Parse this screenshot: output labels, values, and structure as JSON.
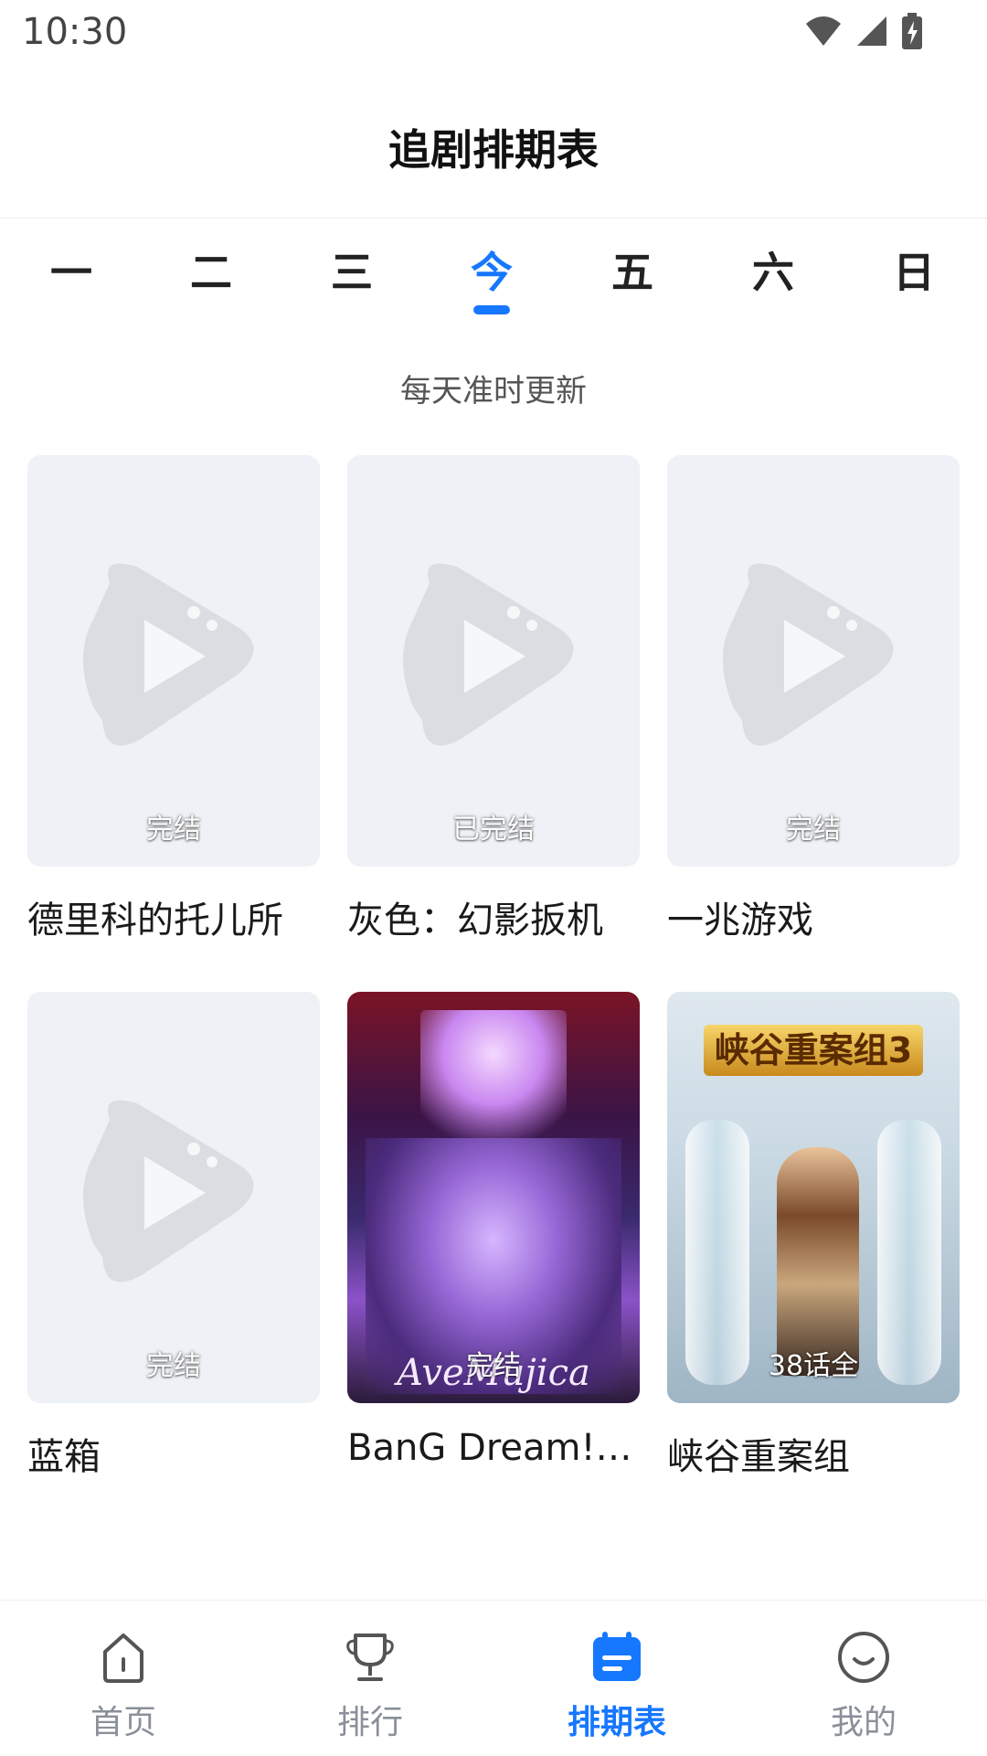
{
  "status_bar": {
    "time": "10:30"
  },
  "header": {
    "title": "追剧排期表"
  },
  "day_tabs": [
    {
      "label": "一",
      "active": false
    },
    {
      "label": "二",
      "active": false
    },
    {
      "label": "三",
      "active": false
    },
    {
      "label": "今",
      "active": true
    },
    {
      "label": "五",
      "active": false
    },
    {
      "label": "六",
      "active": false
    },
    {
      "label": "日",
      "active": false
    }
  ],
  "subtitle": "每天准时更新",
  "shows": [
    {
      "title": "德里科的托儿所",
      "badge": "完结",
      "thumbnail": "placeholder"
    },
    {
      "title": "灰色：幻影扳机",
      "badge": "已完结",
      "thumbnail": "placeholder"
    },
    {
      "title": "一兆游戏",
      "badge": "完结",
      "thumbnail": "placeholder"
    },
    {
      "title": "蓝箱",
      "badge": "完结",
      "thumbnail": "placeholder"
    },
    {
      "title": "BanG Dream! Av…",
      "badge": "完结",
      "thumbnail": "poster",
      "poster_text": "AveMujica"
    },
    {
      "title": "峡谷重案组",
      "badge": "38话全",
      "thumbnail": "poster",
      "poster_text": "峡谷重案组3"
    }
  ],
  "bottom_nav": [
    {
      "label": "首页",
      "icon": "home-icon",
      "active": false
    },
    {
      "label": "排行",
      "icon": "trophy-icon",
      "active": false
    },
    {
      "label": "排期表",
      "icon": "calendar-icon",
      "active": true
    },
    {
      "label": "我的",
      "icon": "profile-icon",
      "active": false
    }
  ],
  "colors": {
    "accent": "#1677ff",
    "placeholder_bg": "#eef1f5",
    "placeholder_icon": "#dadde2"
  }
}
